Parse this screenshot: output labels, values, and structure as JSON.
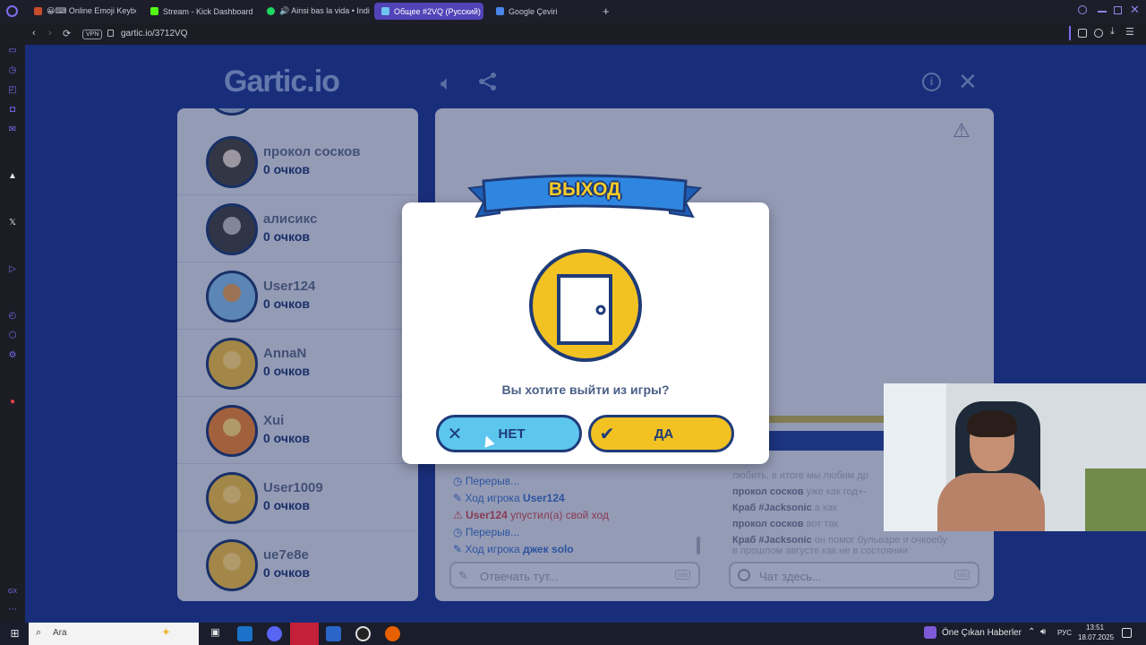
{
  "browser": {
    "tabs": [
      {
        "label": "😀⌨ Online Emoji Keybo",
        "active": false,
        "favicon_color": "#c74d2a"
      },
      {
        "label": "Stream - Kick Dashboard",
        "active": false,
        "favicon_color": "#53fc18"
      },
      {
        "label": "🔊 Ainsi bas la vida • Indi",
        "active": false,
        "favicon_color": "#1ed760"
      },
      {
        "label": "Общее #2VQ (Русский)",
        "active": true,
        "favicon_color": "#6ec4ee"
      },
      {
        "label": "Google Çeviri",
        "active": false,
        "favicon_color": "#4a86e8"
      }
    ],
    "new_tab": "+",
    "vpn_label": "VPN",
    "url": "gartic.io/3712VQ"
  },
  "game": {
    "logo": "Gartic.io",
    "players": [
      {
        "name": "прокол сосков",
        "points": "0 очков"
      },
      {
        "name": "алисикс",
        "points": "0 очков"
      },
      {
        "name": "User124",
        "points": "0 очков"
      },
      {
        "name": "AnnaN",
        "points": "0 очков"
      },
      {
        "name": "Xui",
        "points": "0 очков"
      },
      {
        "name": "User1009",
        "points": "0 очков"
      },
      {
        "name": "ue7e8e",
        "points": "0 очков"
      }
    ],
    "log": {
      "partial_top": "...",
      "l1": "Перерыв...",
      "l2_prefix": "Ход игрока",
      "l2_name": "User124",
      "l3_name": "User124",
      "l3_suffix": "упустил(а) свой ход",
      "l4": "Перерыв...",
      "l5_prefix": "Ход игрока",
      "l5_name": "джек solo"
    },
    "answer_placeholder": "Отвечать тут...",
    "tab_hint": "tab",
    "chat": {
      "c0": "любить, в итоге мы любим др",
      "c1_name": "прокол сосков",
      "c1_text": "уже как год+-",
      "c2_name": "Краб #Jacksonic",
      "c2_text": "а как",
      "c3_name": "прокол сосков",
      "c3_text": "вот так",
      "c4_name": "Краб #Jacksonic",
      "c4_text": "он помог бульваре и очкоебу",
      "c5": "в прошлом августе как не в состоянии"
    },
    "chat_placeholder": "Чат здесь..."
  },
  "modal": {
    "title": "ВЫХОД",
    "message": "Вы хотите выйти из игры?",
    "no_label": "НЕТ",
    "yes_label": "ДА"
  },
  "taskbar": {
    "search_placeholder": "Ara",
    "news": "Öne Çıkan Haberler",
    "lang": "РУС",
    "time": "13:51",
    "date": "18.07.2025"
  }
}
